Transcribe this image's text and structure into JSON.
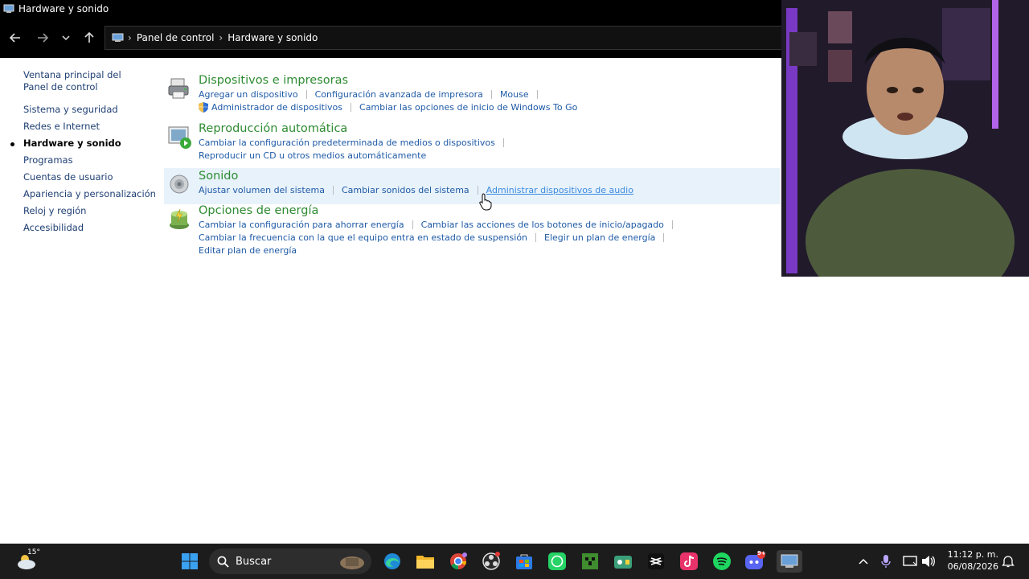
{
  "window": {
    "title": "Hardware y sonido"
  },
  "address": {
    "crumbs": [
      "Panel de control",
      "Hardware y sonido"
    ]
  },
  "sidebar": {
    "items": [
      {
        "label": "Ventana principal del Panel de control"
      },
      {
        "label": "Sistema y seguridad"
      },
      {
        "label": "Redes e Internet"
      },
      {
        "label": "Hardware y sonido",
        "active": true
      },
      {
        "label": "Programas"
      },
      {
        "label": "Cuentas de usuario"
      },
      {
        "label": "Apariencia y personalización"
      },
      {
        "label": "Reloj y región"
      },
      {
        "label": "Accesibilidad"
      }
    ]
  },
  "categories": {
    "devices": {
      "title": "Dispositivos e impresoras",
      "links": [
        "Agregar un dispositivo",
        "Configuración avanzada de impresora",
        "Mouse",
        "Administrador de dispositivos",
        "Cambiar las opciones de inicio de Windows To Go"
      ]
    },
    "autoplay": {
      "title": "Reproducción automática",
      "links": [
        "Cambiar la configuración predeterminada de medios o dispositivos",
        "Reproducir un CD u otros medios automáticamente"
      ]
    },
    "sound": {
      "title": "Sonido",
      "links": [
        "Ajustar volumen del sistema",
        "Cambiar sonidos del sistema",
        "Administrar dispositivos de audio"
      ]
    },
    "power": {
      "title": "Opciones de energía",
      "links": [
        "Cambiar la configuración para ahorrar energía",
        "Cambiar las acciones de los botones de inicio/apagado",
        "Cambiar la frecuencia con la que el equipo entra en estado de suspensión",
        "Elegir un plan de energía",
        "Editar plan de energía"
      ]
    }
  },
  "taskbar": {
    "weather": "15°",
    "search_label": "Buscar",
    "time": "11:12 p. m.",
    "date": "06/08/2026",
    "discord_badge": "9+",
    "apps": [
      "start-icon",
      "edge-icon",
      "file-explorer-icon",
      "chrome-icon",
      "obs-icon",
      "store-icon",
      "whatsapp-icon",
      "minecraft-icon",
      "app-icon",
      "capcut-icon",
      "tiktok-icon",
      "spotify-icon",
      "discord-icon",
      "control-panel-icon"
    ]
  },
  "colors": {
    "category_title": "#2e8b32",
    "link": "#1e5aa6",
    "link_hover": "#3b8be0",
    "highlight_row": "#e8f2fb"
  }
}
